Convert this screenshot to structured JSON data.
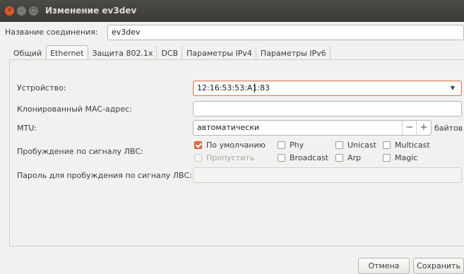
{
  "window": {
    "title": "Изменение ev3dev",
    "close_glyph": "✕",
    "min_glyph": "–",
    "max_glyph": "□"
  },
  "connection": {
    "name_label": "Название соединения:",
    "name_value": "ev3dev"
  },
  "tabs": [
    {
      "label": "Общий",
      "active": false
    },
    {
      "label": "Ethernet",
      "active": true
    },
    {
      "label": "Защита 802.1x",
      "active": false
    },
    {
      "label": "DCB",
      "active": false
    },
    {
      "label": "Параметры IPv4",
      "active": false
    },
    {
      "label": "Параметры IPv6",
      "active": false
    }
  ],
  "ethernet": {
    "device_label": "Устройство:",
    "device_value": "12:16:53:53:A1:83",
    "dropdown_glyph": "▼",
    "cloned_mac_label": "Клонированный MAC-адрес:",
    "cloned_mac_value": "",
    "mtu_label": "MTU:",
    "mtu_value": "автоматически",
    "mtu_minus": "−",
    "mtu_plus": "+",
    "mtu_unit": "байтов",
    "wol_label": "Пробуждение по сигналу ЛВС:",
    "wol_options": [
      {
        "label": "По умолчанию",
        "checked": true,
        "disabled": false
      },
      {
        "label": "Phy",
        "checked": false,
        "disabled": false
      },
      {
        "label": "Unicast",
        "checked": false,
        "disabled": false
      },
      {
        "label": "Multicast",
        "checked": false,
        "disabled": false
      },
      {
        "label": "Пропустить",
        "checked": false,
        "disabled": true
      },
      {
        "label": "Broadcast",
        "checked": false,
        "disabled": false
      },
      {
        "label": "Arp",
        "checked": false,
        "disabled": false
      },
      {
        "label": "Magic",
        "checked": false,
        "disabled": false
      }
    ],
    "wol_password_label": "Пароль для пробуждения по сигналу ЛВС:",
    "wol_password_value": ""
  },
  "buttons": {
    "cancel": "Отмена",
    "save": "Сохранить"
  },
  "colors": {
    "accent": "#e2703f",
    "titlebar": "#3c3b37",
    "focus_border": "#e57e56"
  }
}
